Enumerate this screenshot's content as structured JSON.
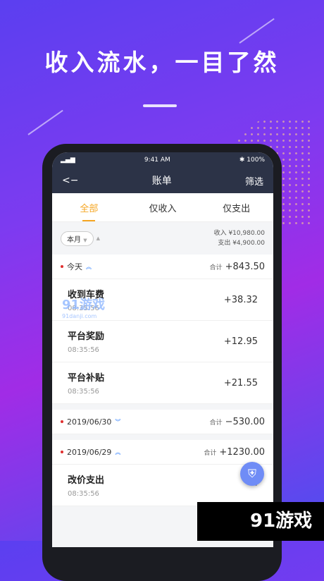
{
  "headline": "收入流水，一目了然",
  "status_bar": {
    "time": "9:41 AM",
    "battery": "100%"
  },
  "nav": {
    "back_icon": "back-arrow-icon",
    "title": "账单",
    "filter": "筛选"
  },
  "tabs": [
    {
      "label": "全部",
      "active": true
    },
    {
      "label": "仅收入"
    },
    {
      "label": "仅支出"
    }
  ],
  "summary": {
    "month": "本月",
    "income": "收入 ¥10,980.00",
    "expense": "支出 ¥4,900.00"
  },
  "groups": [
    {
      "date": "今天",
      "total_label": "合计",
      "total": "+843.50",
      "items": [
        {
          "title": "收到车费",
          "time": "08:35:56",
          "amount": "+38.32"
        },
        {
          "title": "平台奖励",
          "time": "08:35:56",
          "amount": "+12.95"
        },
        {
          "title": "平台补贴",
          "time": "08:35:56",
          "amount": "+21.55"
        }
      ]
    },
    {
      "date": "2019/06/30",
      "total_label": "合计",
      "total": "−530.00",
      "items": []
    },
    {
      "date": "2019/06/29",
      "total_label": "合计",
      "total": "+1230.00",
      "items": [
        {
          "title": "改价支出",
          "time": "08:35:56",
          "amount": "−"
        }
      ]
    }
  ],
  "watermark": {
    "text": "91游戏",
    "url": "91danji.com"
  },
  "colors": {
    "accent": "#f5a623",
    "nav_bg": "#2c3347",
    "expense_dot": "#e02f2f"
  }
}
